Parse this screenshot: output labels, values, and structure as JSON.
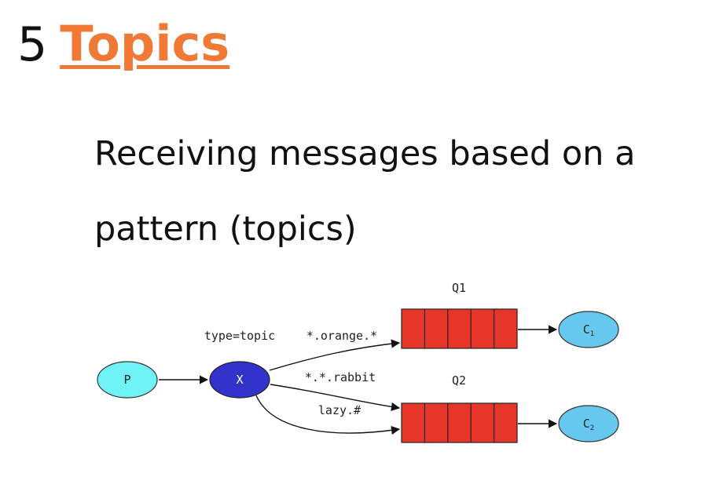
{
  "heading": {
    "number": "5",
    "link_text": "Topics",
    "link_color": "#f07a35"
  },
  "subtitle": "Receiving messages based on a pattern (topics)",
  "diagram": {
    "producer": "P",
    "exchange": "X",
    "exchange_type": "type=topic",
    "queues": [
      {
        "name": "Q1"
      },
      {
        "name": "Q2"
      }
    ],
    "bindings": [
      {
        "key": "*.orange.*"
      },
      {
        "key": "*.*.rabbit"
      },
      {
        "key": "lazy.#"
      }
    ],
    "consumers": [
      {
        "label": "C",
        "subscript": "1"
      },
      {
        "label": "C",
        "subscript": "2"
      }
    ],
    "colors": {
      "producer_fill": "#6ff3f7",
      "exchange_fill": "#3333cc",
      "queue_fill": "#e8352a",
      "consumer_fill": "#66c8ef"
    }
  }
}
